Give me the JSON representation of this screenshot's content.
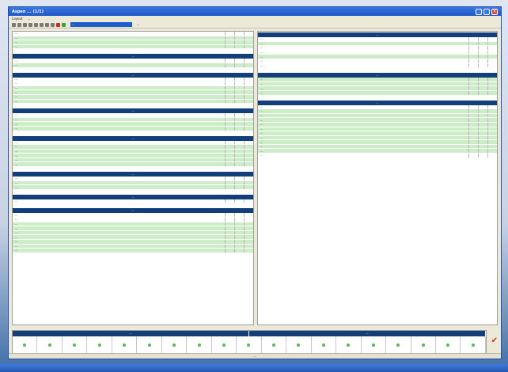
{
  "window": {
    "title": "Aspen ... (1/1)"
  },
  "menubar": {
    "items": [
      "Layout",
      "..."
    ]
  },
  "toolbar": {
    "combo_value": "...",
    "label": "..."
  },
  "left_pane": {
    "sections": [
      {
        "header": "",
        "rows": [
          {
            "label": "...",
            "v1": "",
            "v2": "",
            "v3": "",
            "green": false
          },
          {
            "label": "...",
            "v1": "",
            "v2": "",
            "v3": "",
            "green": true
          },
          {
            "label": "...",
            "v1": "",
            "v2": "",
            "v3": "",
            "green": true
          },
          {
            "label": "...",
            "v1": "",
            "v2": "",
            "v3": "",
            "green": true
          }
        ]
      },
      {
        "header": "...",
        "rows": [
          {
            "label": "...",
            "v1": "",
            "v2": "",
            "v3": "",
            "green": false
          },
          {
            "label": "...",
            "v1": "",
            "v2": "",
            "v3": "",
            "green": true
          }
        ]
      },
      {
        "header": "...",
        "rows": [
          {
            "label": "...",
            "v1": "",
            "v2": "",
            "v3": "",
            "green": false
          },
          {
            "label": "...",
            "v1": "",
            "v2": "",
            "v3": "",
            "green": false
          },
          {
            "label": "...",
            "v1": "",
            "v2": "",
            "v3": "",
            "green": true
          },
          {
            "label": "...",
            "v1": "",
            "v2": "",
            "v3": "",
            "green": true
          },
          {
            "label": "...",
            "v1": "",
            "v2": "",
            "v3": "",
            "green": true
          },
          {
            "label": "...",
            "v1": "",
            "v2": "",
            "v3": "",
            "green": true
          }
        ]
      },
      {
        "header": "...",
        "rows": [
          {
            "label": "...",
            "v1": "",
            "v2": "",
            "v3": "",
            "green": false
          },
          {
            "label": "...",
            "v1": "",
            "v2": "",
            "v3": "",
            "green": true
          },
          {
            "label": "...",
            "v1": "",
            "v2": "",
            "v3": "",
            "green": true
          },
          {
            "label": "...",
            "v1": "",
            "v2": "",
            "v3": "",
            "green": true
          }
        ]
      },
      {
        "header": "...",
        "rows": [
          {
            "label": "...",
            "v1": "",
            "v2": "",
            "v3": "",
            "green": false
          },
          {
            "label": "...",
            "v1": "",
            "v2": "",
            "v3": "",
            "green": true
          },
          {
            "label": "...",
            "v1": "",
            "v2": "",
            "v3": "",
            "green": true
          },
          {
            "label": "...",
            "v1": "",
            "v2": "",
            "v3": "",
            "green": true
          },
          {
            "label": "...",
            "v1": "",
            "v2": "",
            "v3": "",
            "green": true
          },
          {
            "label": "...",
            "v1": "",
            "v2": "",
            "v3": "",
            "green": true
          }
        ]
      },
      {
        "header": "...",
        "rows": [
          {
            "label": "...",
            "v1": "",
            "v2": "",
            "v3": "",
            "green": false
          },
          {
            "label": "...",
            "v1": "",
            "v2": "",
            "v3": "",
            "green": true
          },
          {
            "label": "...",
            "v1": "",
            "v2": "",
            "v3": "",
            "green": true
          }
        ]
      },
      {
        "header": "...",
        "rows": [
          {
            "label": "...",
            "v1": "",
            "v2": "",
            "v3": "",
            "green": false
          }
        ]
      },
      {
        "header": "...",
        "rows": [
          {
            "label": "...",
            "v1": "",
            "v2": "",
            "v3": "",
            "green": false
          },
          {
            "label": "...",
            "v1": "",
            "v2": "",
            "v3": "",
            "green": false
          },
          {
            "label": "...",
            "v1": "",
            "v2": "",
            "v3": "",
            "green": true
          },
          {
            "label": "...",
            "v1": "",
            "v2": "",
            "v3": "",
            "green": true
          },
          {
            "label": "...",
            "v1": "",
            "v2": "",
            "v3": "",
            "green": true
          },
          {
            "label": "...",
            "v1": "",
            "v2": "",
            "v3": "",
            "green": true
          },
          {
            "label": "...",
            "v1": "",
            "v2": "",
            "v3": "",
            "green": true
          },
          {
            "label": "...",
            "v1": "",
            "v2": "",
            "v3": "",
            "green": true
          },
          {
            "label": "...",
            "v1": "",
            "v2": "",
            "v3": "",
            "green": true
          }
        ]
      }
    ]
  },
  "right_pane": {
    "sections": [
      {
        "header": "...",
        "rows": [
          {
            "label": "...",
            "v1": "",
            "v2": "",
            "v3": "",
            "green": false
          },
          {
            "label": "...",
            "v1": "",
            "v2": "",
            "v3": "",
            "green": true
          },
          {
            "label": "...",
            "v1": "",
            "v2": "",
            "v3": "",
            "green": false
          },
          {
            "label": "...",
            "v1": "",
            "v2": "",
            "v3": "",
            "green": false
          },
          {
            "label": "...",
            "v1": "",
            "v2": "",
            "v3": "",
            "green": true
          },
          {
            "label": "...",
            "v1": "",
            "v2": "",
            "v3": "",
            "green": false
          },
          {
            "label": "...",
            "v1": "",
            "v2": "",
            "v3": "",
            "green": false
          }
        ]
      },
      {
        "header": "...",
        "rows": [
          {
            "label": "...",
            "v1": "",
            "v2": "",
            "v3": "",
            "green": true
          },
          {
            "label": "...",
            "v1": "",
            "v2": "",
            "v3": "",
            "green": true
          },
          {
            "label": "...",
            "v1": "",
            "v2": "",
            "v3": "",
            "green": true
          },
          {
            "label": "...",
            "v1": "",
            "v2": "",
            "v3": "",
            "green": true
          }
        ]
      },
      {
        "header": "...",
        "rows": [
          {
            "label": "...",
            "v1": "",
            "v2": "",
            "v3": "",
            "green": false
          },
          {
            "label": "...",
            "v1": "",
            "v2": "",
            "v3": "",
            "green": true
          },
          {
            "label": "...",
            "v1": "",
            "v2": "",
            "v3": "",
            "green": true
          },
          {
            "label": "...",
            "v1": "",
            "v2": "",
            "v3": "",
            "green": true
          },
          {
            "label": "...",
            "v1": "",
            "v2": "",
            "v3": "",
            "green": true
          },
          {
            "label": "...",
            "v1": "",
            "v2": "",
            "v3": "",
            "green": true
          },
          {
            "label": "...",
            "v1": "",
            "v2": "",
            "v3": "",
            "green": true
          },
          {
            "label": "...",
            "v1": "",
            "v2": "",
            "v3": "",
            "green": true
          },
          {
            "label": "...",
            "v1": "",
            "v2": "",
            "v3": "",
            "green": true
          },
          {
            "label": "...",
            "v1": "",
            "v2": "",
            "v3": "",
            "green": true
          },
          {
            "label": "...",
            "v1": "",
            "v2": "",
            "v3": "",
            "green": true
          },
          {
            "label": "...",
            "v1": "",
            "v2": "",
            "v3": "",
            "green": false
          }
        ]
      }
    ]
  },
  "bottom_panel": {
    "headers": [
      "...",
      "..."
    ],
    "cell_count": 19
  },
  "status": {
    "text": "..."
  },
  "colors": {
    "header_bg": "#123f7a",
    "row_green": "#cdecc8",
    "title_blue": "#1f56c6",
    "accent_red": "#c8362b"
  }
}
